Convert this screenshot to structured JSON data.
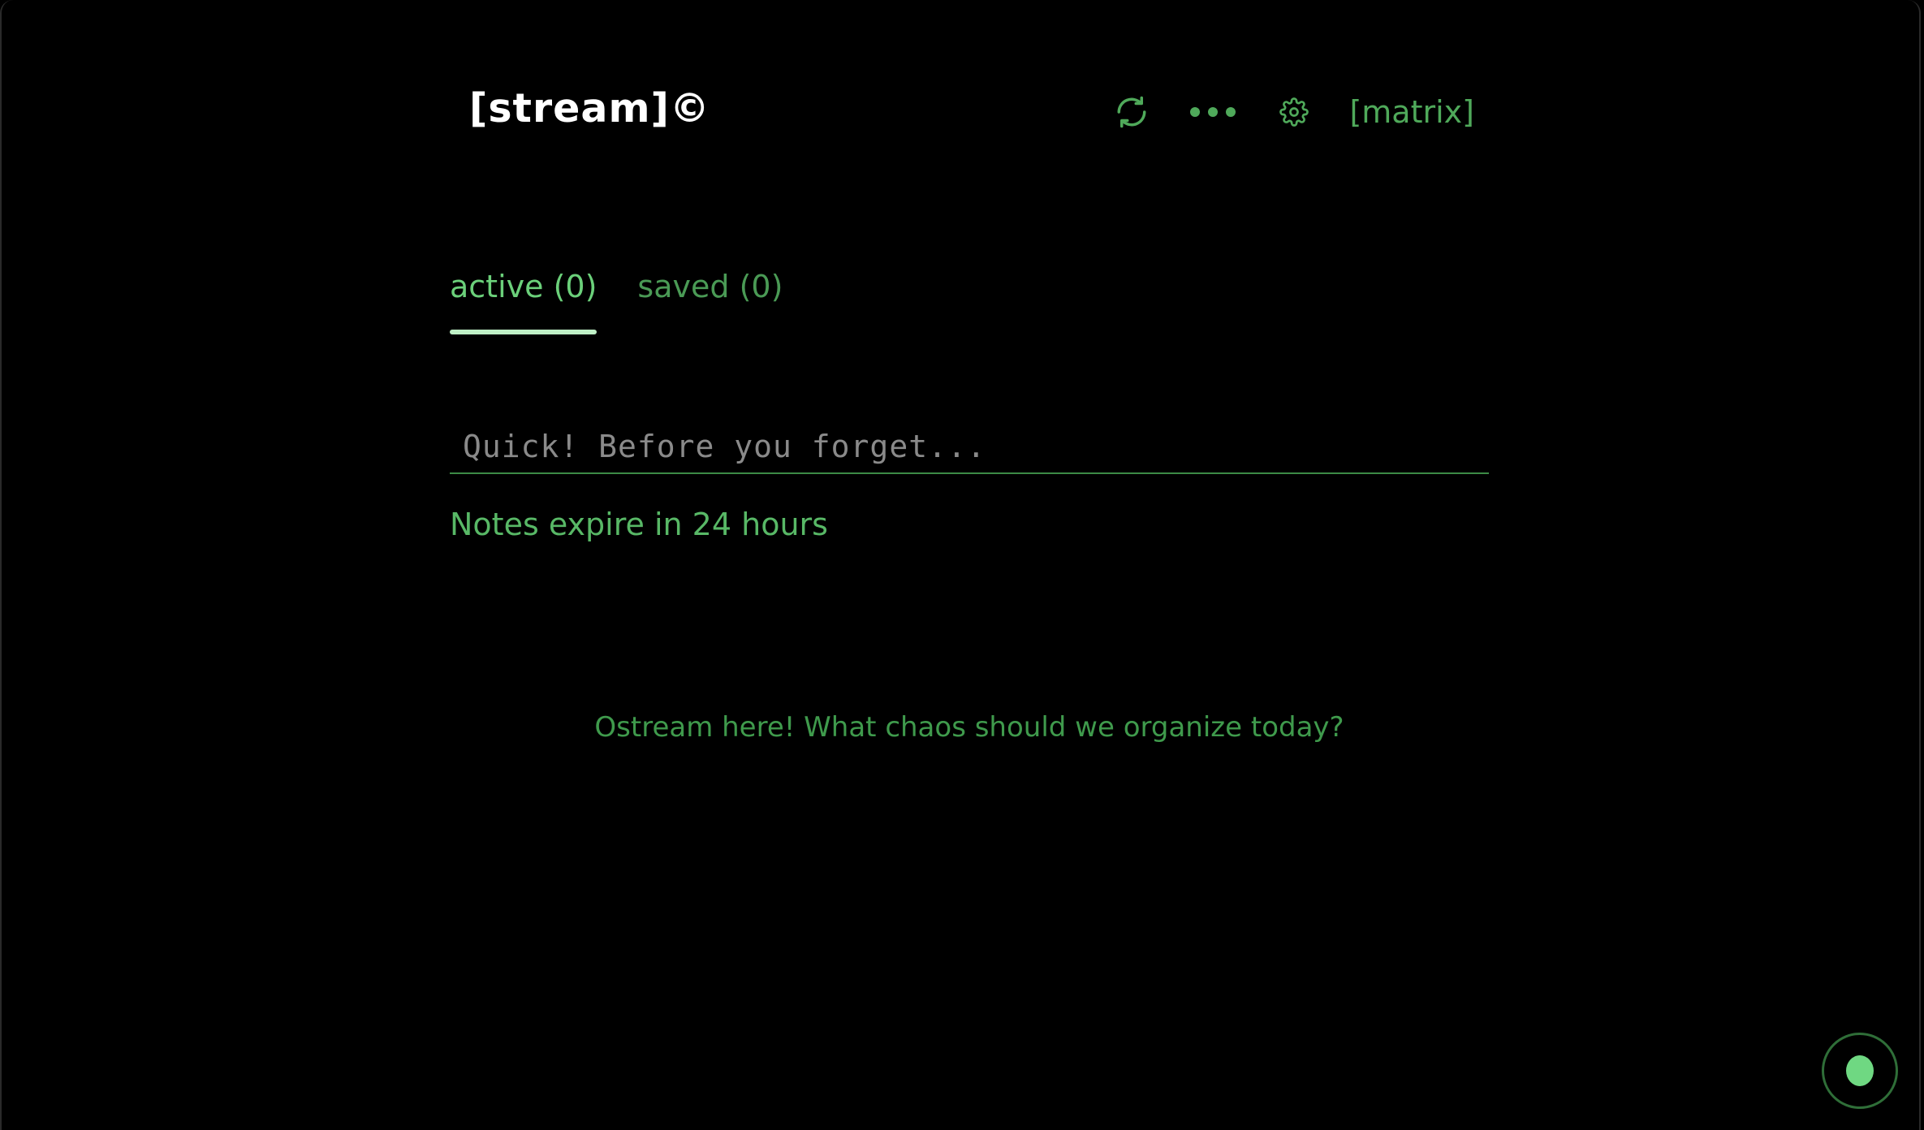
{
  "header": {
    "brand": "[stream]©",
    "actions": {
      "refresh_icon": "refresh-icon",
      "more_icon": "more-horizontal-icon",
      "settings_icon": "gear-icon",
      "theme_label": "[matrix]"
    }
  },
  "tabs": [
    {
      "label": "active (0)",
      "selected": true
    },
    {
      "label": "saved (0)",
      "selected": false
    }
  ],
  "note_input": {
    "value": "",
    "placeholder": "Quick! Before you forget..."
  },
  "expire_notice": "Notes expire in 24 hours",
  "empty_state": {
    "message": "Ostream here! What chaos should we organize today?"
  },
  "fab": {
    "icon": "assistant-orb-icon"
  },
  "colors": {
    "background": "#000000",
    "accent": "#4fa95a",
    "accent_bright": "#6bd07a",
    "tab_underline": "#bff0c6",
    "brand_text": "#ffffff",
    "placeholder": "#8a8a8a"
  }
}
